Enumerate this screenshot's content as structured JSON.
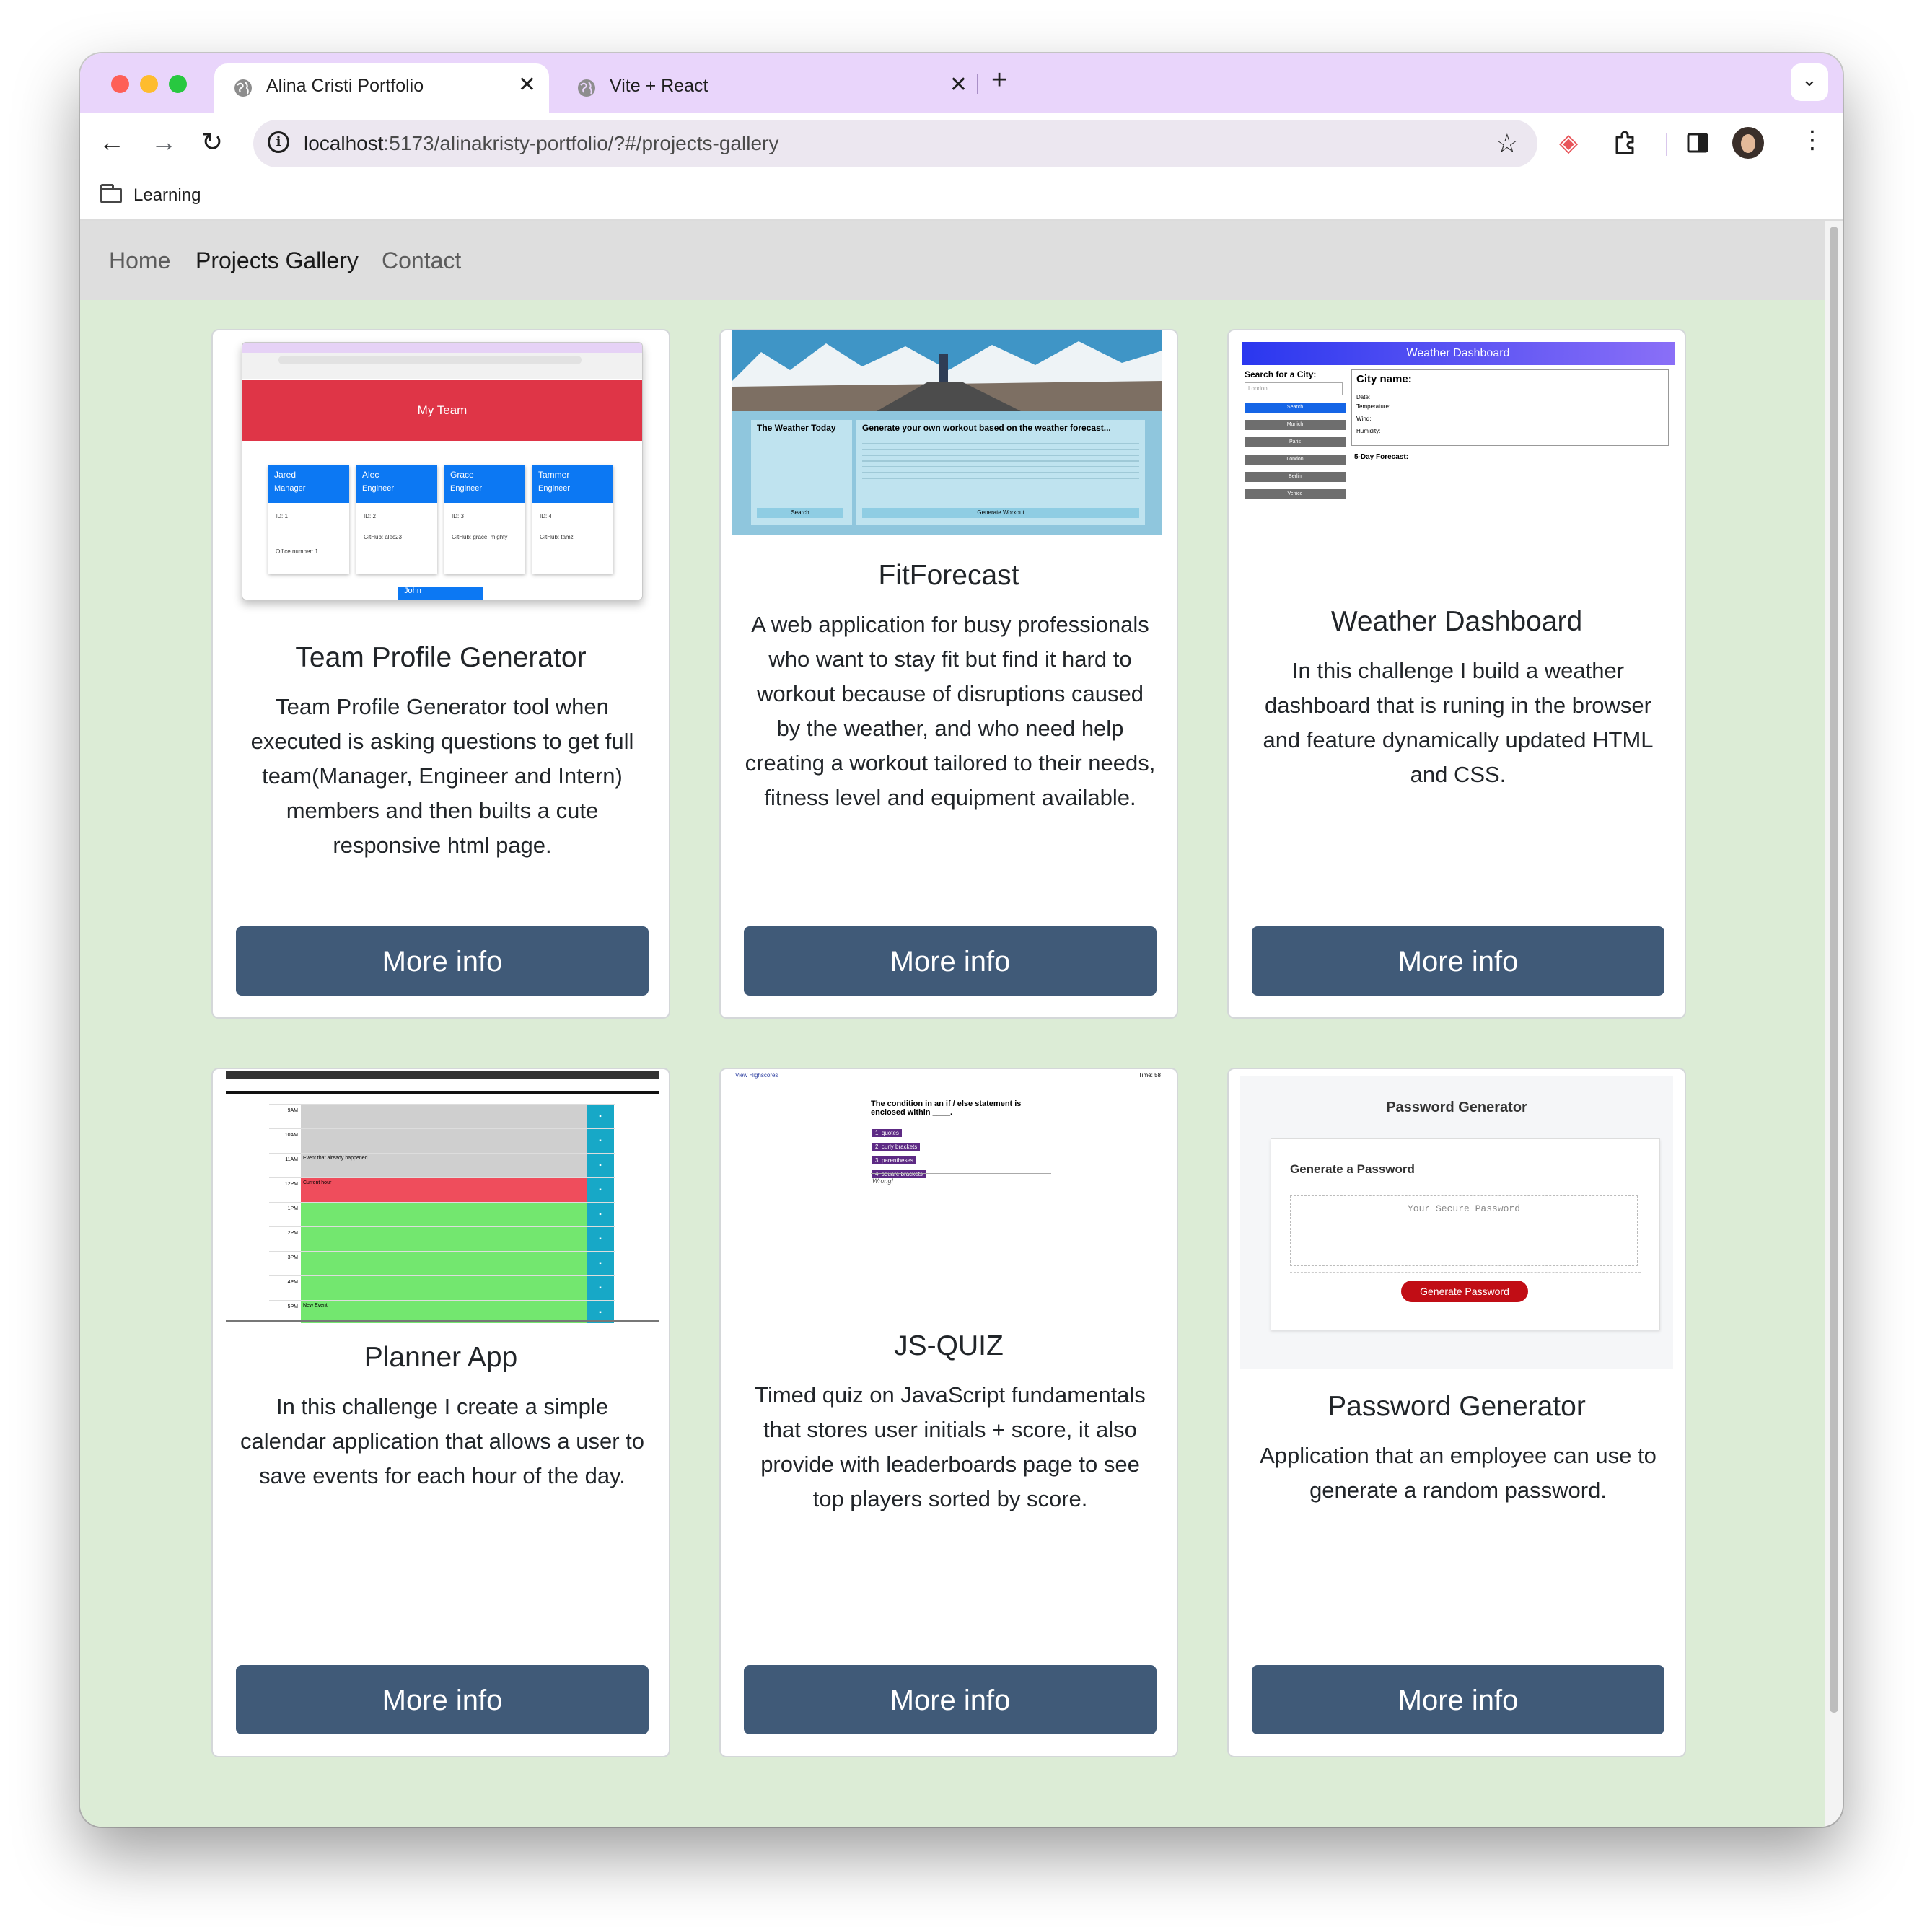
{
  "browser": {
    "tabs": [
      {
        "title": "Alina Cristi Portfolio",
        "close": "✕"
      },
      {
        "title": "Vite + React",
        "close": "✕"
      }
    ],
    "new_tab": "+",
    "url_host": "localhost",
    "url_path": ":5173/alinakristy-portfolio/?#/projects-gallery",
    "bookmarks": [
      {
        "label": "Learning"
      }
    ]
  },
  "site_nav": {
    "home": "Home",
    "projects": "Projects Gallery",
    "contact": "Contact"
  },
  "projects": [
    {
      "title": "Team Profile Generator",
      "description": "Team Profile Generator tool when executed is asking questions to get full team(Manager, Engineer and Intern) members and then builts a cute responsive html page.",
      "button": "More info",
      "thumb": {
        "header": "My Team",
        "members": [
          {
            "name": "Jared",
            "role": "Manager",
            "id": "ID: 1",
            "extra": "Office number: 1"
          },
          {
            "name": "Alec",
            "role": "Engineer",
            "id": "ID: 2",
            "extra": "GitHub: alec23"
          },
          {
            "name": "Grace",
            "role": "Engineer",
            "id": "ID: 3",
            "extra": "GitHub: grace_mighty"
          },
          {
            "name": "Tammer",
            "role": "Engineer",
            "id": "ID: 4",
            "extra": "GitHub: tamz"
          }
        ],
        "next_member": "John"
      }
    },
    {
      "title": "FitForecast",
      "description": "A web application for busy professionals who want to stay fit but find it hard to workout because of disruptions caused by the weather, and who need help creating a workout tailored to their needs, fitness level and equipment available.",
      "button": "More info",
      "thumb": {
        "weather_heading": "The Weather Today",
        "workout_heading": "Generate your own workout based on the weather forecast...",
        "search": "Search",
        "generate": "Generate Workout"
      }
    },
    {
      "title": "Weather Dashboard",
      "description": "In this challenge I build a weather dashboard that is runing in the browser and feature dynamically updated HTML and CSS.",
      "button": "More info",
      "thumb": {
        "header": "Weather Dashboard",
        "search_label": "Search for a City:",
        "placeholder": "London",
        "search": "Search",
        "cities": [
          "Munich",
          "Paris",
          "London",
          "Berlin",
          "Venice"
        ],
        "city_name": "City name:",
        "fields": [
          "Date:",
          "Temperature:",
          "Wind:",
          "Humidity:"
        ],
        "forecast": "5-Day Forecast:"
      }
    },
    {
      "title": "Planner App",
      "description": "In this challenge I create a simple calendar application that allows a user to save events for each hour of the day.",
      "button": "More info",
      "thumb": {
        "hours": [
          "9AM",
          "10AM",
          "11AM",
          "12PM",
          "1PM",
          "2PM",
          "3PM",
          "4PM",
          "5PM"
        ],
        "events": [
          "",
          "",
          "Event that already happened",
          "Current hour",
          "",
          "",
          "",
          "",
          "New Event"
        ]
      }
    },
    {
      "title": "JS-QUIZ",
      "description": "Timed quiz on JavaScript fundamentals that stores user initials + score, it also provide with leaderboards page to see top players sorted by score.",
      "button": "More info",
      "thumb": {
        "highscores": "View Highscores",
        "timer": "Time: 58",
        "question": "The condition in an if / else statement is enclosed within ____.",
        "answers": [
          "1. quotes",
          "2. curly brackets",
          "3. parentheses",
          "4. square brackets"
        ],
        "feedback": "Wrong!"
      }
    },
    {
      "title": "Password Generator",
      "description": "Application that an employee can use to generate a random password.",
      "button": "More info",
      "thumb": {
        "header": "Password Generator",
        "subheader": "Generate a Password",
        "placeholder": "Your Secure Password",
        "button": "Generate Password"
      }
    }
  ],
  "colors": {
    "page_bg": "#dcecd6",
    "button": "#405a78",
    "tab_strip": "#e9d5fb"
  }
}
